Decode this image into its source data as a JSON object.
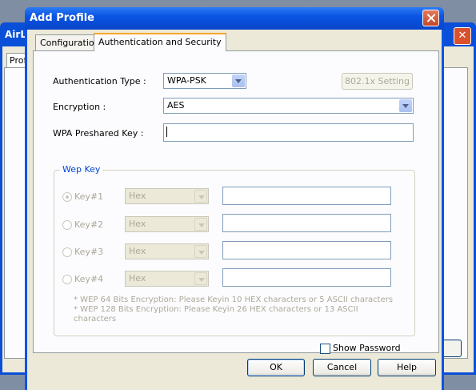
{
  "background_window": {
    "title": "AirLi",
    "tab_label": "Profi",
    "close_glyph": "✕"
  },
  "dialog": {
    "title": "Add Profile"
  },
  "tabs": [
    {
      "label": "Configuration"
    },
    {
      "label": "Authentication and Security"
    }
  ],
  "auth": {
    "auth_type_label": "Authentication Type :",
    "auth_type_value": "WPA-PSK",
    "dot1x_button": "802.1x Setting",
    "encryption_label": "Encryption :",
    "encryption_value": "AES",
    "preshared_label": "WPA Preshared Key :",
    "preshared_value": ""
  },
  "wep": {
    "group_title": "Wep Key",
    "keys": [
      {
        "label": "Key#1",
        "format": "Hex",
        "value": "",
        "selected": true
      },
      {
        "label": "Key#2",
        "format": "Hex",
        "value": "",
        "selected": false
      },
      {
        "label": "Key#3",
        "format": "Hex",
        "value": "",
        "selected": false
      },
      {
        "label": "Key#4",
        "format": "Hex",
        "value": "",
        "selected": false
      }
    ],
    "note_line1": "* WEP 64 Bits Encryption:  Please Keyin 10 HEX characters or 5 ASCII characters",
    "note_line2": "* WEP 128 Bits Encryption:  Please Keyin 26 HEX characters or 13 ASCII",
    "note_line3": "characters"
  },
  "show_password": {
    "label": "Show Password",
    "checked": false
  },
  "buttons": {
    "ok": "OK",
    "cancel": "Cancel",
    "help": "Help"
  }
}
